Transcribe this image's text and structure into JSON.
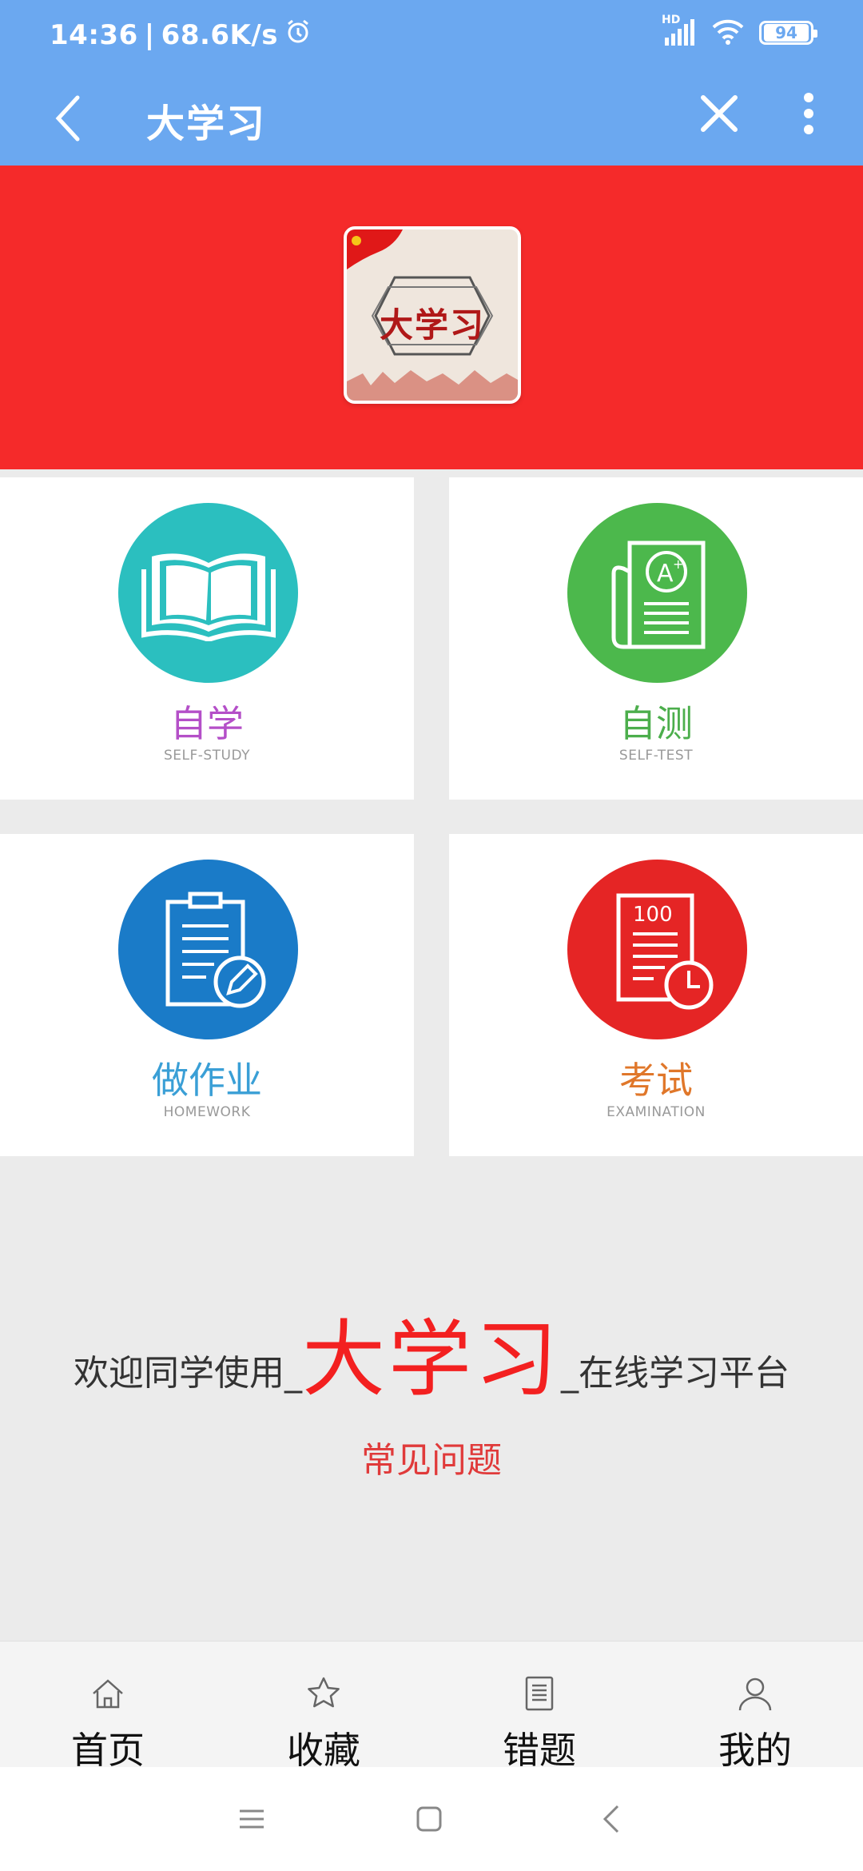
{
  "status_bar": {
    "time": "14:36",
    "speed": "68.6K/s",
    "network": "HD",
    "battery": "94"
  },
  "app_bar": {
    "title": "大学习"
  },
  "banner": {
    "logo_text": "大学习"
  },
  "tiles": [
    {
      "label": "自学",
      "sub": "SELF-STUDY",
      "color": "#b44fc8",
      "circle": "#2bbfbf",
      "icon": "book-icon"
    },
    {
      "label": "自测",
      "sub": "SELF-TEST",
      "color": "#4cae4c",
      "circle": "#4cb84c",
      "icon": "test-paper-icon"
    },
    {
      "label": "做作业",
      "sub": "HOMEWORK",
      "color": "#3a9fd6",
      "circle": "#1a7bc8",
      "icon": "clipboard-edit-icon"
    },
    {
      "label": "考试",
      "sub": "EXAMINATION",
      "color": "#e0772a",
      "circle": "#e52525",
      "icon": "exam-clock-icon",
      "score": "100"
    }
  ],
  "welcome": {
    "prefix": "欢迎同学使用_",
    "brand": "大学习",
    "suffix": "_在线学习平台"
  },
  "faq_link": "常见问题",
  "tabbar": [
    {
      "label": "首页",
      "icon": "home-icon"
    },
    {
      "label": "收藏",
      "icon": "star-icon"
    },
    {
      "label": "错题",
      "icon": "document-icon"
    },
    {
      "label": "我的",
      "icon": "person-icon"
    }
  ]
}
